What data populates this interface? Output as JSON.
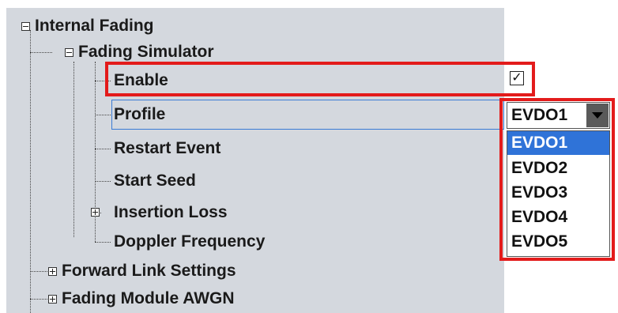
{
  "tree": {
    "internal_fading": "Internal Fading",
    "fading_simulator": "Fading Simulator",
    "enable": "Enable",
    "profile": "Profile",
    "restart_event": "Restart Event",
    "start_seed": "Start Seed",
    "insertion_loss": "Insertion Loss",
    "doppler_frequency": "Doppler Frequency",
    "forward_link_settings": "Forward Link Settings",
    "fading_module_awgn": "Fading Module AWGN"
  },
  "enable_checked": true,
  "checkbox_mark": "✓",
  "profile_dropdown": {
    "selected": "EVDO1",
    "options": [
      "EVDO1",
      "EVDO2",
      "EVDO3",
      "EVDO4",
      "EVDO5"
    ],
    "highlighted": "EVDO1"
  },
  "colors": {
    "highlight_box": "#e31b1b",
    "selection": "#2f73d8",
    "tree_background": "#d4d8de"
  }
}
